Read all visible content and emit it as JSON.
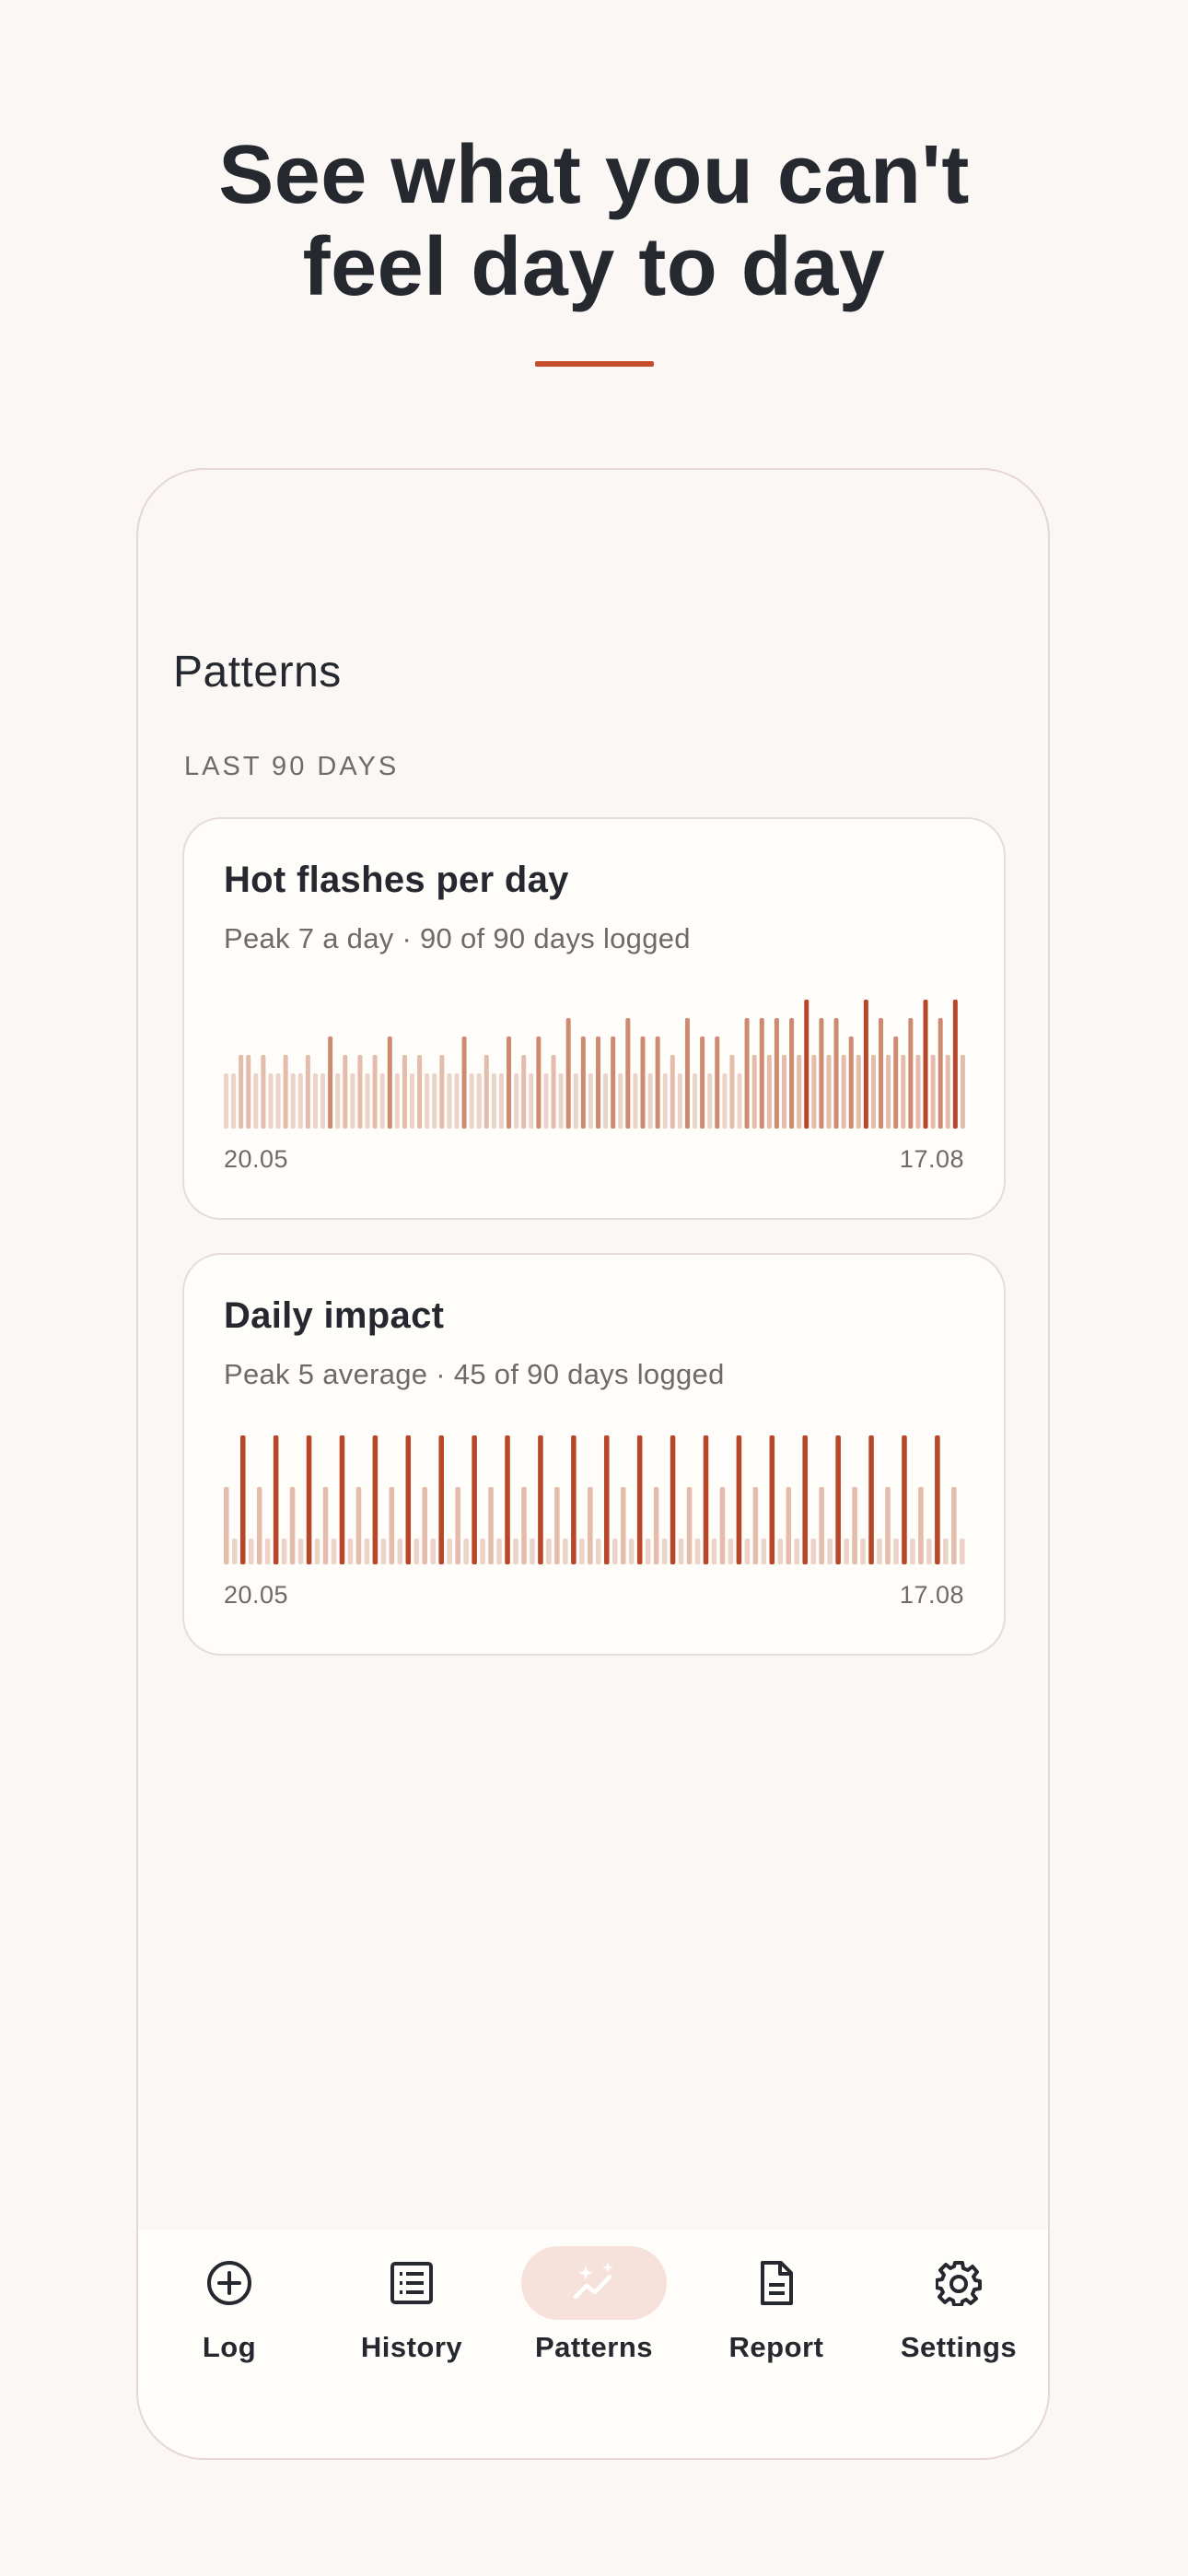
{
  "headline": {
    "line1": "See what you can't",
    "line2": "feel day to day"
  },
  "colors": {
    "accent": "#c44d2c",
    "bar_light": "#e3bcab",
    "bar_pale": "#ecd3c8",
    "bar_mid": "#cf8a72",
    "bar_strong": "#b8472a",
    "tab_active_bg": "#f6e2db"
  },
  "screen": {
    "title": "Patterns",
    "section_label": "LAST 90 DAYS"
  },
  "cards": [
    {
      "title": "Hot flashes per day",
      "subtitle": "Peak 7 a day · 90 of 90 days logged",
      "start_date": "20.05",
      "end_date": "17.08"
    },
    {
      "title": "Daily impact",
      "subtitle": "Peak 5 average · 45 of 90 days logged",
      "start_date": "20.05",
      "end_date": "17.08"
    }
  ],
  "chart_data": [
    {
      "type": "bar",
      "title": "Hot flashes per day",
      "x_start": "20.05",
      "x_end": "17.08",
      "ylim": [
        0,
        7
      ],
      "days": 90,
      "values": [
        3,
        3,
        4,
        4,
        3,
        4,
        3,
        3,
        4,
        3,
        3,
        4,
        3,
        3,
        5,
        3,
        4,
        3,
        4,
        3,
        4,
        3,
        5,
        3,
        4,
        3,
        4,
        3,
        3,
        4,
        3,
        3,
        5,
        3,
        3,
        4,
        3,
        3,
        5,
        3,
        4,
        3,
        5,
        3,
        4,
        3,
        6,
        3,
        5,
        3,
        5,
        3,
        5,
        3,
        6,
        3,
        5,
        3,
        5,
        3,
        4,
        3,
        6,
        3,
        5,
        3,
        5,
        3,
        4,
        3,
        6,
        4,
        6,
        4,
        6,
        4,
        6,
        4,
        7,
        4,
        6,
        4,
        6,
        4,
        5,
        4,
        7,
        4,
        6,
        4,
        5,
        4,
        6,
        4,
        7,
        4,
        6,
        4,
        7,
        4
      ],
      "opacity_levels": "darker bars indicate higher-intensity days later in the period"
    },
    {
      "type": "bar",
      "title": "Daily impact",
      "x_start": "20.05",
      "x_end": "17.08",
      "ylim": [
        0,
        5
      ],
      "days": 90,
      "values": [
        3,
        1,
        5,
        1,
        3,
        1,
        5,
        1,
        3,
        1,
        5,
        1,
        3,
        1,
        5,
        1,
        3,
        1,
        5,
        1,
        3,
        1,
        5,
        1,
        3,
        1,
        5,
        1,
        3,
        1,
        5,
        1,
        3,
        1,
        5,
        1,
        3,
        1,
        5,
        1,
        3,
        1,
        5,
        1,
        3,
        1,
        5,
        1,
        3,
        1,
        5,
        1,
        3,
        1,
        5,
        1,
        3,
        1,
        5,
        1,
        3,
        1,
        5,
        1,
        3,
        1,
        5,
        1,
        3,
        1,
        5,
        1,
        3,
        1,
        5,
        1,
        3,
        1,
        5,
        1,
        3,
        1,
        5,
        1,
        3,
        1,
        5,
        1,
        3,
        1
      ]
    }
  ],
  "tabs": [
    {
      "label": "Log",
      "icon": "plus-circle-icon",
      "active": false
    },
    {
      "label": "History",
      "icon": "list-icon",
      "active": false
    },
    {
      "label": "Patterns",
      "icon": "sparkle-trend-icon",
      "active": true
    },
    {
      "label": "Report",
      "icon": "document-icon",
      "active": false
    },
    {
      "label": "Settings",
      "icon": "gear-icon",
      "active": false
    }
  ]
}
